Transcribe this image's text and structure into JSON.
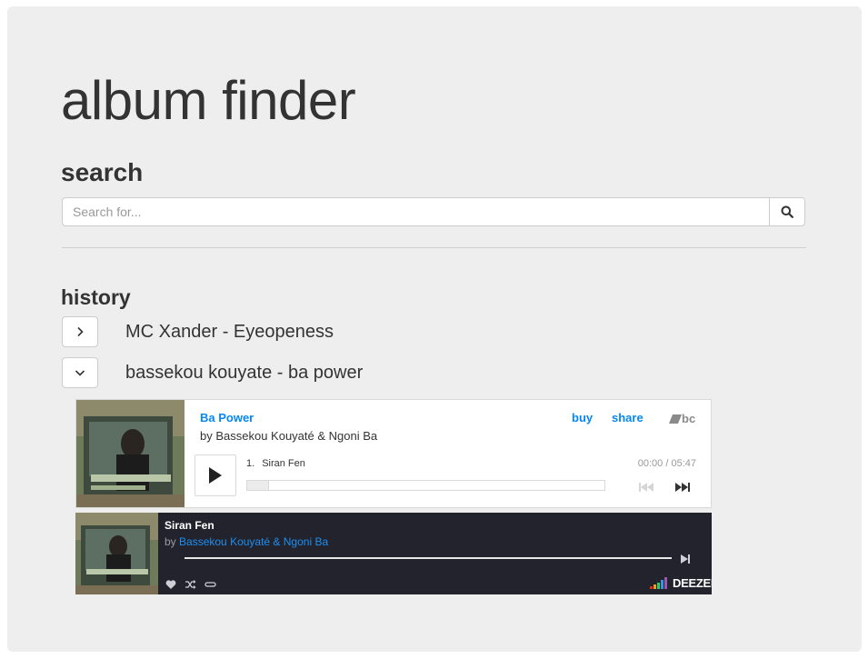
{
  "app": {
    "title": "album finder"
  },
  "search": {
    "heading": "search",
    "placeholder": "Search for...",
    "button_icon": "search-icon"
  },
  "history": {
    "heading": "history",
    "items": [
      {
        "label": "MC Xander - Eyeopeness",
        "toggle_icon": "chevron-right-icon",
        "expanded": false
      },
      {
        "label": "bassekou kouyate - ba power",
        "toggle_icon": "chevron-down-icon",
        "expanded": true
      }
    ]
  },
  "bandcamp_player": {
    "album_title": "Ba Power",
    "artist_line": "by Bassekou Kouyaté & Ngoni Ba",
    "buy_label": "buy",
    "share_label": "share",
    "logo_text": "bc",
    "track_number": "1.",
    "track_title": "Siran Fen",
    "time": "00:00 / 05:47",
    "progress": 0,
    "accent_color": "#0687f5"
  },
  "deezer_player": {
    "track_title": "Siran Fen",
    "by_prefix": "by",
    "artist": "Bassekou Kouyaté & Ngoni Ba",
    "logo_text": "DEEZER",
    "accent_color": "#1e8ff0",
    "background_color": "#23232d"
  }
}
